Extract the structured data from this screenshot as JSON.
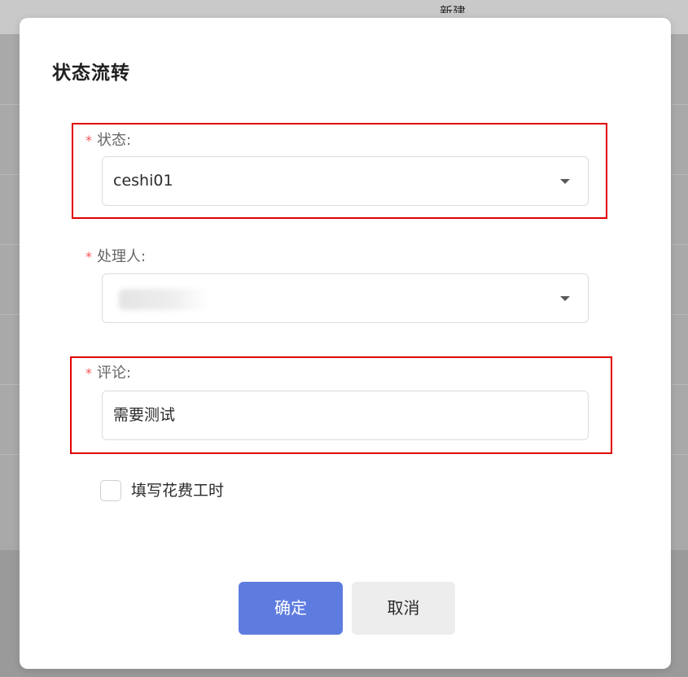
{
  "background": {
    "header_text": "新建"
  },
  "dialog": {
    "title": "状态流转",
    "required_mark": "*",
    "status": {
      "label": "状态:",
      "value": "ceshi01"
    },
    "handler": {
      "label": "处理人:",
      "value_obscured": true
    },
    "comment": {
      "label": "评论:",
      "value": "需要测试"
    },
    "checkbox": {
      "label": "填写花费工时",
      "checked": false
    },
    "buttons": {
      "confirm": "确定",
      "cancel": "取消"
    }
  },
  "colors": {
    "accent": "#5e7ce0",
    "required": "#f5555b",
    "highlight": "#e00000"
  }
}
